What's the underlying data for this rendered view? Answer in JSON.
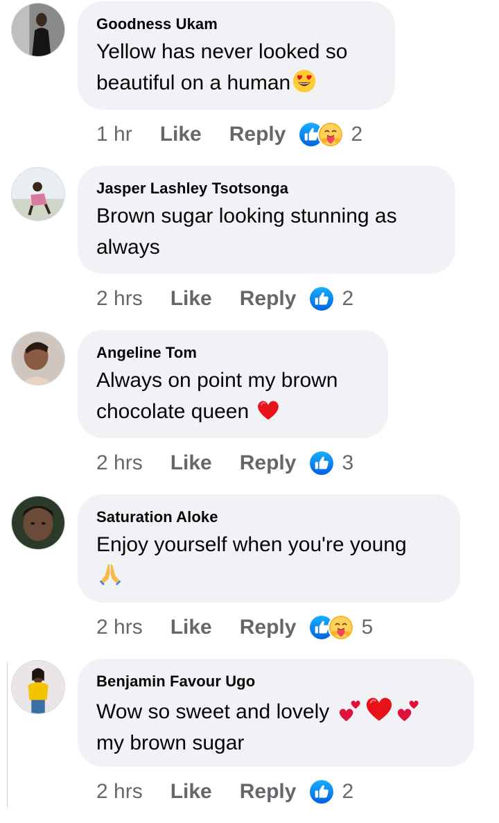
{
  "comments": [
    {
      "author": "Goodness Ukam",
      "text_line1": "Yellow has never looked so",
      "text_line2": "beautiful on a human",
      "emojis": [
        "heart-eyes"
      ],
      "time": "1 hr",
      "like_label": "Like",
      "reply_label": "Reply",
      "reactions": [
        "like",
        "care"
      ],
      "reaction_count": "2"
    },
    {
      "author": "Jasper Lashley Tsotsonga",
      "text_line1": "Brown sugar looking stunning as",
      "text_line2": "always",
      "emojis": [],
      "time": "2 hrs",
      "like_label": "Like",
      "reply_label": "Reply",
      "reactions": [
        "like"
      ],
      "reaction_count": "2"
    },
    {
      "author": "Angeline Tom",
      "text_line1": "Always on point my brown",
      "text_line2": "chocolate queen",
      "emojis": [
        "red-heart"
      ],
      "time": "2 hrs",
      "like_label": "Like",
      "reply_label": "Reply",
      "reactions": [
        "like"
      ],
      "reaction_count": "3"
    },
    {
      "author": "Saturation Aloke",
      "text_line1": "Enjoy yourself when you're young",
      "text_line2": "",
      "emojis": [
        "folded-hands"
      ],
      "time": "2 hrs",
      "like_label": "Like",
      "reply_label": "Reply",
      "reactions": [
        "like",
        "care"
      ],
      "reaction_count": "5"
    },
    {
      "author": "Benjamin Favour Ugo",
      "text_line1": "Wow so sweet and lovely",
      "text_line2": "my brown sugar",
      "emojis": [
        "two-hearts",
        "red-heart",
        "two-hearts"
      ],
      "time": "2 hrs",
      "like_label": "Like",
      "reply_label": "Reply",
      "reactions": [
        "like"
      ],
      "reaction_count": "2"
    }
  ],
  "colors": {
    "bubble": "#f0f2f5",
    "meta_text": "#65676b",
    "like_blue": "#1877f2"
  }
}
